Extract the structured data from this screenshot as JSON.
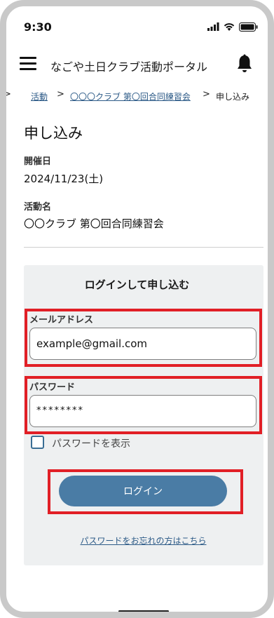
{
  "status_bar": {
    "time": "9:30"
  },
  "app_bar": {
    "title": "なごや土日クラブ活動ポータル"
  },
  "breadcrumb": {
    "items": [
      "活動",
      "〇〇〇クラブ 第〇回合同練習会"
    ],
    "current": "申し込み"
  },
  "page": {
    "title": "申し込み",
    "date_label": "開催日",
    "date_value": "2024/11/23(土)",
    "activity_label": "活動名",
    "activity_value": "〇〇クラブ 第〇回合同練習会"
  },
  "login_panel": {
    "title": "ログインして申し込む",
    "email_label": "メールアドレス",
    "email_value": "example@gmail.com",
    "password_label": "パスワード",
    "password_value": "********",
    "show_password_label": "パスワードを表示",
    "show_password_checked": false,
    "login_button": "ログイン",
    "forgot_link": "パスワードをお忘れの方はこちら"
  },
  "colors": {
    "accent": "#4a7ca5",
    "link": "#2c5a87",
    "highlight": "#e11f26",
    "panel_bg": "#eef0f1"
  },
  "icons": {
    "menu": "hamburger-icon",
    "notification": "bell-icon",
    "signal": "signal-icon",
    "wifi": "wifi-icon",
    "battery": "battery-icon"
  }
}
